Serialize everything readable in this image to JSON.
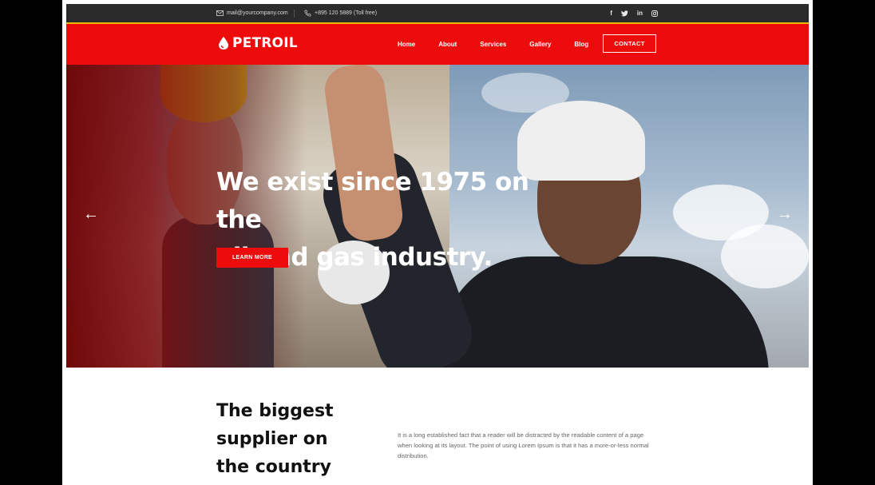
{
  "topbar": {
    "email": "mail@yourcompany.com",
    "phone": "+895 120 5889 (Toll free)",
    "social": {
      "facebook": "f",
      "twitter": "t",
      "linkedin": "in",
      "instagram": "ig"
    }
  },
  "header": {
    "logo_text": "PETROIL",
    "nav": [
      "Home",
      "About",
      "Services",
      "Gallery",
      "Blog"
    ],
    "contact_label": "CONTACT"
  },
  "hero": {
    "title_line1": "We exist since 1975 on the",
    "title_line2": "oil and gas industry.",
    "button_label": "LEARN MORE",
    "prev_icon": "←",
    "next_icon": "→"
  },
  "about": {
    "title_line1": "The biggest",
    "title_line2": "supplier on",
    "title_line3": "the country",
    "text": "It is a long established fact that a reader will be distracted by the readable content of a page when looking at its layout. The point of using Lorem Ipsum is that it has a more-or-less normal distribution."
  },
  "colors": {
    "brand_red": "#ee0b0b",
    "topbar": "#2b2b2b",
    "stripe": "#f2b705"
  }
}
